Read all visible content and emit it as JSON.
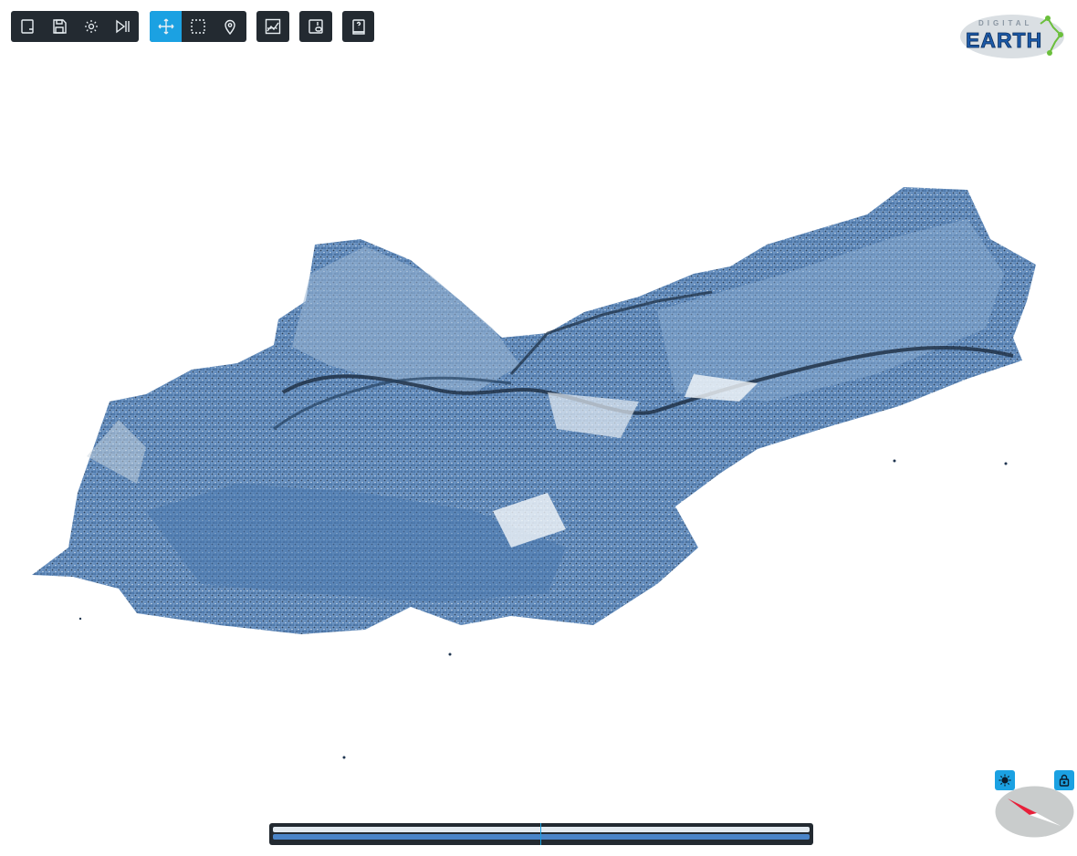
{
  "toolbar": {
    "file_group": [
      "new-file",
      "save",
      "settings",
      "play-pause"
    ],
    "nav_group": [
      "move",
      "select",
      "location"
    ],
    "active_tool": "move"
  },
  "logo": {
    "top_text": "DIGITAL",
    "main_text": "EARTH"
  },
  "colors": {
    "toolbar_bg": "#232a31",
    "accent": "#1ba1e2",
    "cloud_primary": "#5b86b9",
    "cloud_dark": "#1f3550",
    "cloud_light": "#a9c2dd",
    "compass_needle": "#e8203a"
  },
  "icons": {
    "new_file": "new-file-icon",
    "save": "save-icon",
    "settings": "gear-icon",
    "play_pause": "play-pause-icon",
    "move": "move-icon",
    "select": "selection-box-icon",
    "pin": "map-pin-icon",
    "chart": "line-chart-icon",
    "layers": "layers-panel-icon",
    "help": "help-book-icon",
    "sun": "sun-icon",
    "lock": "lock-icon",
    "compass": "compass-icon"
  }
}
